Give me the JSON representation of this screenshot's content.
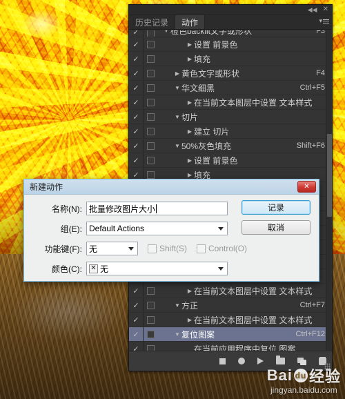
{
  "panel": {
    "titlebar": {
      "collapse_icon": "◀◀",
      "close_icon": "✕"
    },
    "tabs": [
      {
        "label": "历史记录",
        "active": false
      },
      {
        "label": "动作",
        "active": true
      }
    ],
    "menu_icon": "▾",
    "rows": [
      {
        "check": "✓",
        "toggle": true,
        "tri": "▼",
        "indent": 0,
        "label": "橙色backlit文字或形状",
        "shortcut": "F3",
        "selected": false,
        "clipped": true
      },
      {
        "check": "✓",
        "toggle": true,
        "tri": "▶",
        "indent": 2,
        "label": "设置 前景色",
        "shortcut": "",
        "selected": false
      },
      {
        "check": "✓",
        "toggle": true,
        "tri": "▶",
        "indent": 2,
        "label": "填充",
        "shortcut": "",
        "selected": false
      },
      {
        "check": "✓",
        "toggle": true,
        "tri": "▶",
        "indent": 1,
        "label": "黄色文字或形状",
        "shortcut": "F4",
        "selected": false
      },
      {
        "check": "✓",
        "toggle": true,
        "tri": "▼",
        "indent": 1,
        "label": "华文细黑",
        "shortcut": "Ctrl+F5",
        "selected": false
      },
      {
        "check": "✓",
        "toggle": true,
        "tri": "▶",
        "indent": 2,
        "label": "在当前文本图层中设置 文本样式",
        "shortcut": "",
        "selected": false
      },
      {
        "check": "✓",
        "toggle": true,
        "tri": "▼",
        "indent": 1,
        "label": "切片",
        "shortcut": "",
        "selected": false
      },
      {
        "check": "✓",
        "toggle": true,
        "tri": "▶",
        "indent": 2,
        "label": "建立 切片",
        "shortcut": "",
        "selected": false
      },
      {
        "check": "✓",
        "toggle": true,
        "tri": "▼",
        "indent": 1,
        "label": "50%灰色填充",
        "shortcut": "Shift+F6",
        "selected": false
      },
      {
        "check": "✓",
        "toggle": true,
        "tri": "▶",
        "indent": 2,
        "label": "设置 前景色",
        "shortcut": "",
        "selected": false
      },
      {
        "check": "✓",
        "toggle": true,
        "tri": "▶",
        "indent": 2,
        "label": "填充",
        "shortcut": "",
        "selected": false
      },
      {
        "check": "✓",
        "toggle": true,
        "tri": "▼",
        "indent": 1,
        "label": "",
        "shortcut": "",
        "selected": false
      },
      {
        "check": "✓",
        "toggle": true,
        "tri": "",
        "indent": 2,
        "label": "",
        "shortcut": "",
        "selected": false
      },
      {
        "check": "✓",
        "toggle": true,
        "tri": "",
        "indent": 2,
        "label": "",
        "shortcut": "",
        "selected": false
      },
      {
        "check": "✓",
        "toggle": true,
        "tri": "",
        "indent": 2,
        "label": "",
        "shortcut": "",
        "selected": false
      },
      {
        "check": "✓",
        "toggle": true,
        "tri": "",
        "indent": 2,
        "label": "",
        "shortcut": "",
        "selected": false
      },
      {
        "check": "✓",
        "toggle": true,
        "tri": "",
        "indent": 2,
        "label": "",
        "shortcut": "",
        "selected": false
      },
      {
        "check": "✓",
        "toggle": true,
        "tri": "",
        "indent": 2,
        "label": "",
        "shortcut": "",
        "selected": false
      },
      {
        "check": "✓",
        "toggle": true,
        "tri": "▶",
        "indent": 2,
        "label": "在当前文本图层中设置 文本样式",
        "shortcut": "",
        "selected": false
      },
      {
        "check": "✓",
        "toggle": true,
        "tri": "▼",
        "indent": 1,
        "label": "方正",
        "shortcut": "Ctrl+F7",
        "selected": false
      },
      {
        "check": "✓",
        "toggle": true,
        "tri": "▶",
        "indent": 2,
        "label": "在当前文本图层中设置 文本样式",
        "shortcut": "",
        "selected": false
      },
      {
        "check": "✓",
        "toggle": true,
        "tri": "▼",
        "indent": 1,
        "label": "复位图案",
        "shortcut": "Ctrl+F12",
        "selected": true
      },
      {
        "check": "✓",
        "toggle": true,
        "tri": "",
        "indent": 2,
        "label": "在当前应用程序中复位 图案",
        "shortcut": "",
        "selected": false
      }
    ],
    "footer": {
      "stop": "stop-icon",
      "record": "record-icon",
      "play": "play-icon",
      "folder": "new-set-icon",
      "new_action": "new-action-icon",
      "trash": "delete-icon"
    }
  },
  "dialog": {
    "title": "新建动作",
    "close_label": "✕",
    "name_label": "名称(N):",
    "name_value": "批量修改图片大小",
    "group_label": "组(E):",
    "group_value": "Default Actions",
    "fkey_label": "功能键(F):",
    "fkey_value": "无",
    "shift_label": "Shift(S)",
    "control_label": "Control(O)",
    "color_label": "颜色(C):",
    "color_swatch": "✕",
    "color_value": "无",
    "record_button": "记录",
    "cancel_button": "取消"
  },
  "watermark": {
    "brand_a": "Bai",
    "brand_paw": "du",
    "brand_b": "经验",
    "url": "jingyan.baidu.com"
  },
  "colors": {
    "panel_bg": "#323232",
    "list_bg": "#343434",
    "selection": "#6b7390",
    "dialog_bg": "#eef0f0",
    "dialog_border": "#7fc4e8",
    "close_red": "#cf3b33"
  }
}
